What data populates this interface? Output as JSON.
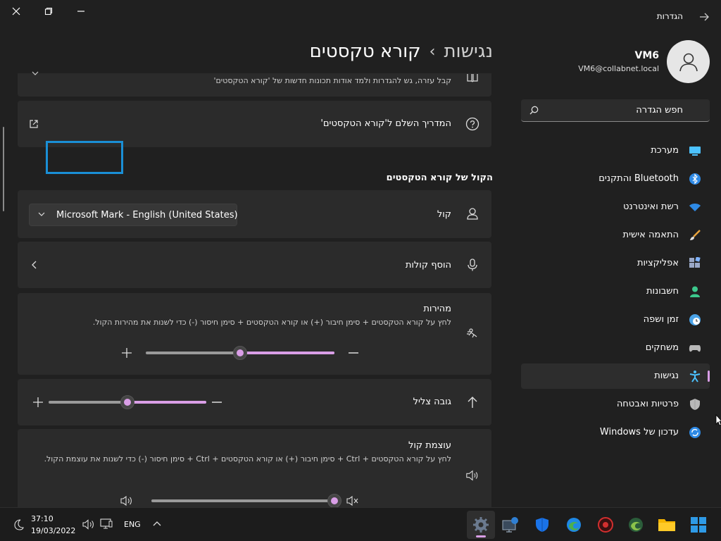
{
  "window": {
    "title": "הגדרות",
    "buttons": [
      "close",
      "restore",
      "minimize"
    ]
  },
  "user": {
    "name": "VM6",
    "email": "VM6@collabnet.local"
  },
  "search": {
    "placeholder": "חפש הגדרה"
  },
  "sidebar": {
    "items": [
      {
        "label": "מערכת",
        "icon": "system-icon",
        "color": "#4cc2ff"
      },
      {
        "label": "Bluetooth והתקנים",
        "icon": "bluetooth-icon",
        "color": "#2e8ae6"
      },
      {
        "label": "רשת ואינטרנט",
        "icon": "wifi-icon",
        "color": "#2e8ae6"
      },
      {
        "label": "התאמה אישית",
        "icon": "brush-icon",
        "color": "#e8a33c"
      },
      {
        "label": "אפליקציות",
        "icon": "apps-icon",
        "color": "#9aa8c7"
      },
      {
        "label": "חשבונות",
        "icon": "account-icon",
        "color": "#3cc88c"
      },
      {
        "label": "זמן ושפה",
        "icon": "clock-globe-icon",
        "color": "#4aa3e8"
      },
      {
        "label": "משחקים",
        "icon": "gamepad-icon",
        "color": "#b8b8b8"
      },
      {
        "label": "נגישות",
        "icon": "accessibility-icon",
        "color": "#4cc2ff",
        "active": true
      },
      {
        "label": "פרטיות ואבטחה",
        "icon": "shield-icon",
        "color": "#b8b8b8"
      },
      {
        "label": "עדכון של Windows",
        "icon": "update-icon",
        "color": "#2e8ae6"
      }
    ]
  },
  "header": {
    "parent": "נגישות",
    "separator": "›",
    "current": "קורא טקסטים"
  },
  "cards": {
    "help": {
      "desc": "קבל עזרה, גש להגדרות ולמד אודות תכונות חדשות של 'קורא הטקסטים'"
    },
    "guide": {
      "title": "המדריך השלם ל'קורא הטקסטים'"
    },
    "section_title": "הקול של קורא הטקסטים",
    "voice": {
      "title": "קול",
      "selected": "Microsoft Mark - English (United States)"
    },
    "add_voices": {
      "title": "הוסף קולות"
    },
    "speed": {
      "title": "מהירות",
      "desc": "לחץ על קורא הטקסטים + סימן חיבור (+) או קורא הטקסטים + סימן חיסור (-) כדי לשנות את מהירות הקול.",
      "value": 0.5
    },
    "pitch": {
      "title": "גובה צליל",
      "value": 0.5
    },
    "volume": {
      "title": "עוצמת קול",
      "desc": "לחץ על קורא הטקסטים + Ctrl + סימן חיבור (+) או קורא הטקסטים + Ctrl + סימן חיסור (-) כדי לשנות את עוצמת הקול.",
      "value": 0.0
    }
  },
  "taskbar": {
    "apps": [
      "start",
      "file-explorer",
      "edge-dev",
      "app-red",
      "edge",
      "defender",
      "remote-desktop",
      "settings"
    ],
    "lang": "ENG",
    "time": "37:10",
    "date": "19/03/2022"
  }
}
